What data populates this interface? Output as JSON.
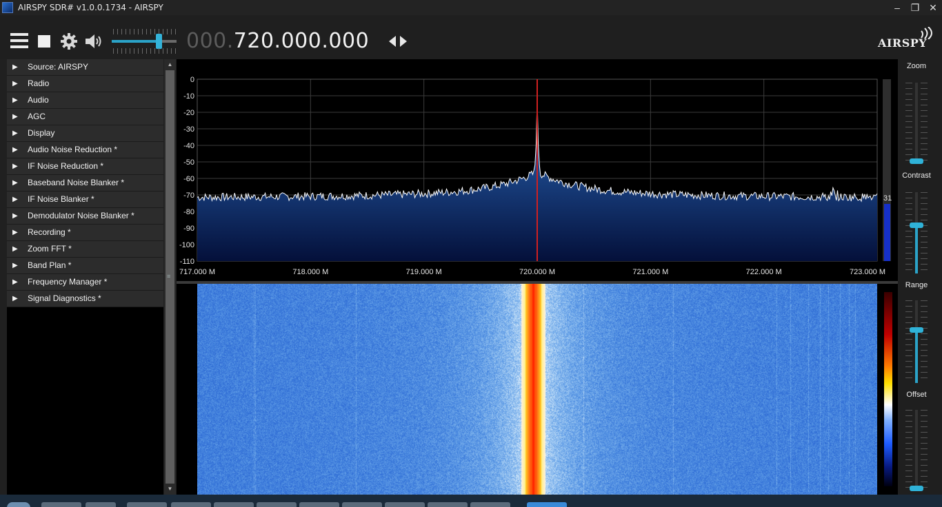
{
  "window": {
    "title": "AIRSPY SDR# v1.0.0.1734 - AIRSPY",
    "minimize_glyph": "–",
    "restore_glyph": "❐",
    "close_glyph": "✕"
  },
  "toolbar": {
    "frequency_prefix": "000.",
    "frequency_main": "720.000.000",
    "volume_level": 0.72,
    "brand": "AIRSPY"
  },
  "sidebar": {
    "items": [
      {
        "label": "Source: AIRSPY"
      },
      {
        "label": "Radio"
      },
      {
        "label": "Audio"
      },
      {
        "label": "AGC"
      },
      {
        "label": "Display"
      },
      {
        "label": "Audio Noise Reduction *"
      },
      {
        "label": "IF Noise Reduction *"
      },
      {
        "label": "Baseband Noise Blanker *"
      },
      {
        "label": "IF Noise Blanker *"
      },
      {
        "label": "Demodulator Noise Blanker *"
      },
      {
        "label": "Recording *"
      },
      {
        "label": "Zoom FFT *"
      },
      {
        "label": "Band Plan *"
      },
      {
        "label": "Frequency Manager *"
      },
      {
        "label": "Signal Diagnostics *"
      }
    ],
    "expand_glyph": "▶"
  },
  "spectrum": {
    "y_ticks": [
      "0",
      "-10",
      "-20",
      "-30",
      "-40",
      "-50",
      "-60",
      "-70",
      "-80",
      "-90",
      "-100",
      "-110"
    ],
    "x_ticks": [
      "717.000 M",
      "718.000 M",
      "719.000 M",
      "720.000 M",
      "721.000 M",
      "722.000 M",
      "723.000 M"
    ],
    "y_range_db": [
      -110,
      0
    ],
    "x_range_mhz": [
      717.0,
      723.0
    ],
    "center_mhz": 720.0,
    "peak_db": -12,
    "noise_floor_db": -72,
    "level_readout": "31",
    "colors": {
      "fill_top": "#2c6cc0",
      "fill_bottom": "#04103a",
      "trace": "#ffffff",
      "marker": "#d02020"
    }
  },
  "right_panel": {
    "zoom_label": "Zoom",
    "contrast_label": "Contrast",
    "range_label": "Range",
    "offset_label": "Offset",
    "zoom_level": 0.0,
    "contrast_level": 0.6,
    "range_level": 0.65,
    "offset_level": 0.0
  }
}
